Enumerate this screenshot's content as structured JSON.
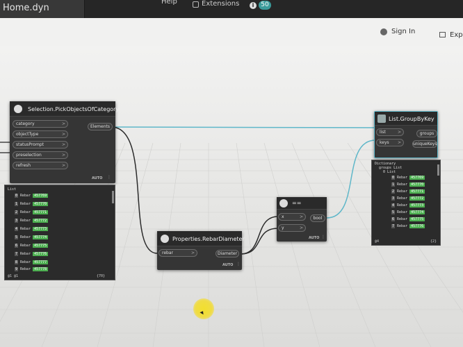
{
  "window": {
    "tab_title": "Home.dyn"
  },
  "menu": {
    "help_label": "Help",
    "extensions_label": "Extensions",
    "notification_count": "50"
  },
  "toolbar": {
    "signin_label": "Sign In",
    "export_label": "Exp"
  },
  "nodes": {
    "pick": {
      "title": "Selection.PickObjectsOfCategory",
      "inputs": [
        "category",
        "objectType",
        "statusPrompt",
        "preselection",
        "refresh"
      ],
      "output": "Elements",
      "lacing": "AUTO"
    },
    "diameter": {
      "title": "Properties.RebarDiameter",
      "input": "rebar",
      "output": "Diameter",
      "lacing": "AUTO"
    },
    "equals": {
      "title": "==",
      "inputs": [
        "x",
        "y"
      ],
      "output": "bool",
      "lacing": "AUTO"
    },
    "groupbykey": {
      "title": "List.GroupByKey",
      "inputs": [
        "list",
        "keys"
      ],
      "outputs": [
        "groups",
        "uniqueKeys"
      ]
    }
  },
  "preview_left": {
    "header": "List",
    "rows": [
      {
        "idx": "0",
        "type": "Rebar",
        "id": "457769"
      },
      {
        "idx": "1",
        "type": "Rebar",
        "id": "457770"
      },
      {
        "idx": "2",
        "type": "Rebar",
        "id": "457771"
      },
      {
        "idx": "3",
        "type": "Rebar",
        "id": "457772"
      },
      {
        "idx": "4",
        "type": "Rebar",
        "id": "457773"
      },
      {
        "idx": "5",
        "type": "Rebar",
        "id": "457774"
      },
      {
        "idx": "6",
        "type": "Rebar",
        "id": "457775"
      },
      {
        "idx": "7",
        "type": "Rebar",
        "id": "457776"
      },
      {
        "idx": "8",
        "type": "Rebar",
        "id": "457777"
      },
      {
        "idx": "9",
        "type": "Rebar",
        "id": "457778"
      }
    ],
    "footer_left": "@1 @1",
    "footer_right": "{70}"
  },
  "preview_right": {
    "header": "Dictionary",
    "subheader": "groups List",
    "subheader2": "0 List",
    "rows": [
      {
        "idx": "0",
        "type": "Rebar",
        "id": "457769"
      },
      {
        "idx": "1",
        "type": "Rebar",
        "id": "457770"
      },
      {
        "idx": "2",
        "type": "Rebar",
        "id": "457771"
      },
      {
        "idx": "3",
        "type": "Rebar",
        "id": "457772"
      },
      {
        "idx": "4",
        "type": "Rebar",
        "id": "457773"
      },
      {
        "idx": "5",
        "type": "Rebar",
        "id": "457774"
      },
      {
        "idx": "6",
        "type": "Rebar",
        "id": "457775"
      },
      {
        "idx": "7",
        "type": "Rebar",
        "id": "457776"
      }
    ],
    "footer_left": "@4",
    "footer_right": "{2}"
  },
  "colors": {
    "wire": "#2b2b2b",
    "wire_selected": "#5fb7c9",
    "accent": "#3b9b9b",
    "value_green": "#4caf50"
  }
}
